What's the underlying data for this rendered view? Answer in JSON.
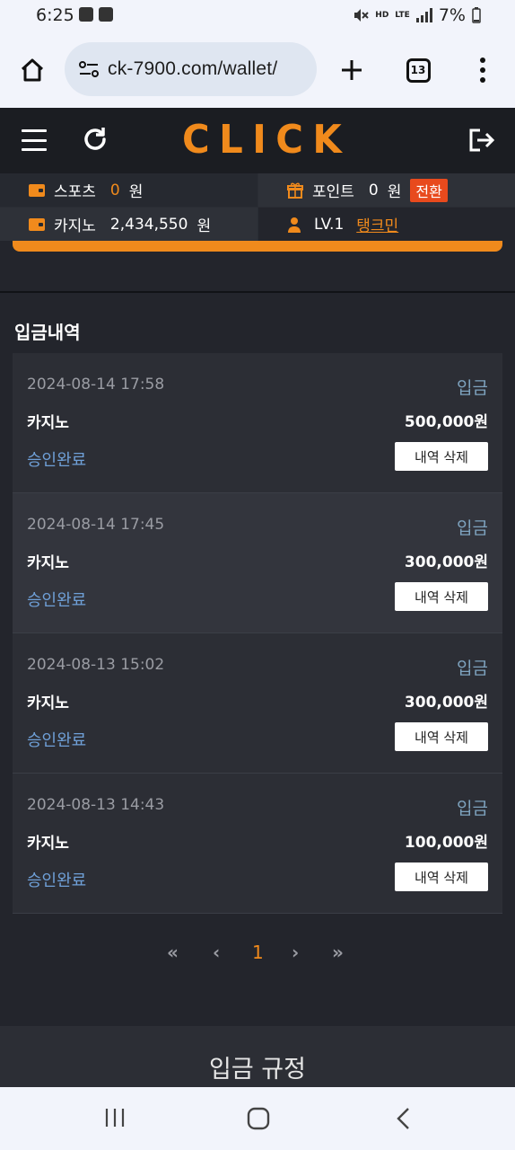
{
  "status_bar": {
    "time": "6:25",
    "battery": "7%",
    "network": "LTE"
  },
  "browser": {
    "url": "ck-7900.com/wallet/",
    "tab_count": "13"
  },
  "header": {
    "logo": "CLICK"
  },
  "info": {
    "sports_label": "스포츠",
    "sports_value": "0",
    "sports_unit": "원",
    "point_label": "포인트",
    "point_value": "0",
    "point_unit": "원",
    "convert_label": "전환",
    "casino_label": "카지노",
    "casino_value": "2,434,550",
    "casino_unit": "원",
    "level": "LV.1",
    "nickname": "탱크민"
  },
  "section_title": "입금내역",
  "history": [
    {
      "date": "2024-08-14 17:58",
      "type": "입금",
      "game": "카지노",
      "amount": "500,000원",
      "status": "승인완료",
      "delete_label": "내역 삭제"
    },
    {
      "date": "2024-08-14 17:45",
      "type": "입금",
      "game": "카지노",
      "amount": "300,000원",
      "status": "승인완료",
      "delete_label": "내역 삭제"
    },
    {
      "date": "2024-08-13 15:02",
      "type": "입금",
      "game": "카지노",
      "amount": "300,000원",
      "status": "승인완료",
      "delete_label": "내역 삭제"
    },
    {
      "date": "2024-08-13 14:43",
      "type": "입금",
      "game": "카지노",
      "amount": "100,000원",
      "status": "승인완료",
      "delete_label": "내역 삭제"
    }
  ],
  "pagination": {
    "first": "«",
    "prev": "‹",
    "current": "1",
    "next": "›",
    "last": "»"
  },
  "rules_title": "입금 규정",
  "colors": {
    "accent": "#f08a1c",
    "convert": "#e84a1d",
    "status": "#6fa0d8",
    "type": "#7ea3bf"
  }
}
